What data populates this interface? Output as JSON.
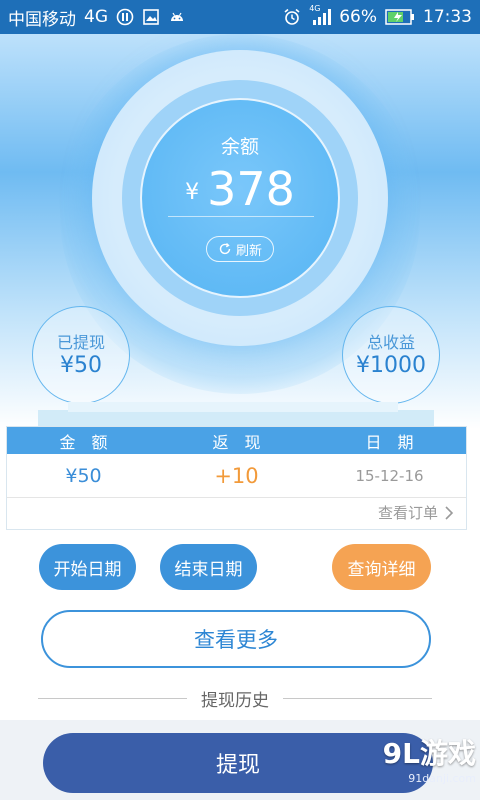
{
  "status_bar": {
    "carrier": "中国移动",
    "network": "4G",
    "small_network": "4G",
    "battery": "66%",
    "time": "17:33"
  },
  "balance": {
    "label": "余额",
    "currency": "¥",
    "amount": "378",
    "refresh_label": "刷新"
  },
  "withdrawn": {
    "label": "已提现",
    "value": "¥50"
  },
  "total_income": {
    "label": "总收益",
    "value": "¥1000"
  },
  "table": {
    "headers": [
      "金　额",
      "返　现",
      "日　期"
    ],
    "rows": [
      {
        "amount": "¥50",
        "rebate": "+10",
        "date": "15-12-16"
      }
    ],
    "orders_link": "查看订单"
  },
  "buttons": {
    "start_date": "开始日期",
    "end_date": "结束日期",
    "query_details": "查询详细",
    "view_more": "查看更多",
    "withdraw": "提现"
  },
  "history_label": "提现历史",
  "watermark": {
    "logo": "9L游戏",
    "url": "91danji.com"
  },
  "colors": {
    "status_bar": "#1e6fb8",
    "primary_blue": "#3c93db",
    "orange": "#f5a353",
    "withdraw_button": "#3a5ea9"
  }
}
